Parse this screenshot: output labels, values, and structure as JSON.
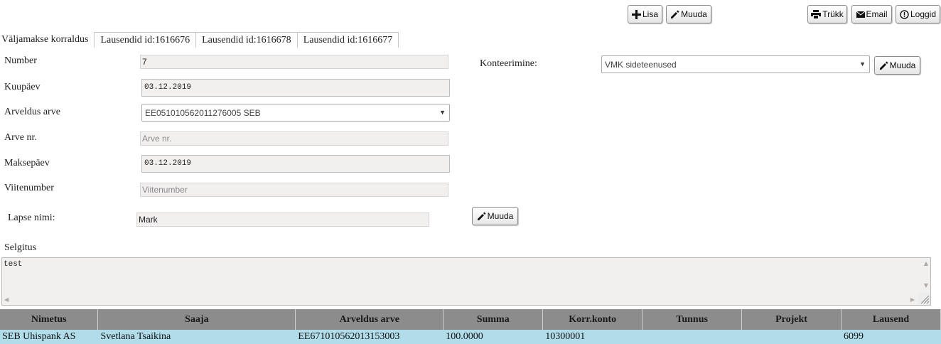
{
  "toolbar": {
    "add_label": "Lisa",
    "edit_label": "Muuda",
    "print_label": "Trükk",
    "email_label": "Email",
    "logs_label": "Loggid"
  },
  "tabs": [
    "Väljamakse korraldus",
    "Lausendid id:1616676",
    "Lausendid id:1616678",
    "Lausendid id:1616677"
  ],
  "form": {
    "number_label": "Number",
    "number_value": "7",
    "kuupaev_label": "Kuupäev",
    "kuupaev_value": "03.12.2019",
    "arveldus_label": "Arveldus arve",
    "arveldus_value": "EE051010562011276005 SEB",
    "arve_nr_label": "Arve nr.",
    "arve_nr_placeholder": "Arve nr.",
    "maksepaev_label": "Maksepäev",
    "maksepaev_value": "03.12.2019",
    "viitenumber_label": "Viitenumber",
    "viitenumber_placeholder": "Viitenumber",
    "lapse_nimi_label": "Lapse nimi:",
    "lapse_nimi_value": "Mark",
    "lapse_edit_label": "Muuda",
    "konteerimine_label": "Konteerimine:",
    "konteerimine_value": "VMK sideteenused",
    "konteerimine_edit_label": "Muuda",
    "selgitus_label": "Selgitus",
    "selgitus_value": "test"
  },
  "grid": {
    "columns": [
      "Nimetus",
      "Saaja",
      "Arveldus arve",
      "Summa",
      "Korr.konto",
      "Tunnus",
      "Projekt",
      "Lausend"
    ],
    "rows": [
      [
        "SEB Uhispank AS",
        "Svetlana Tsaikina",
        "EE671010562013153003",
        "100.0000",
        "10300001",
        "",
        "",
        "6099"
      ]
    ]
  },
  "colors": {
    "header_bg": "#8c8c8c",
    "row_bg": "#b1dcea",
    "field_bg": "#f2efef"
  }
}
